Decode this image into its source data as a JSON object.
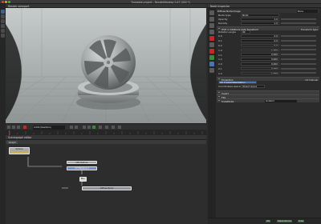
{
  "window": {
    "title": "Tuneable project - RenderMonkey 0.47 (002 *)"
  },
  "viewport_panel": {
    "title": "Render viewport"
  },
  "timeline": {
    "frame_value": "0.000 (Realtime)"
  },
  "graph_panel": {
    "title": "Scenegraph editor",
    "tab": "Graph",
    "nodes": [
      {
        "label": "Sphere"
      },
      {
        "label": "DIN Texture"
      },
      {
        "label": "UV Mapping 1"
      },
      {
        "label": "Blur"
      },
      {
        "label": "Diffuse Rend"
      }
    ]
  },
  "inspector": {
    "title": "Node Inspector",
    "tab_labels": [
      "Diffuse  Node Image",
      "None"
    ],
    "rows": [
      {
        "label": "Node type",
        "value": "Node"
      },
      {
        "label": "Opacity",
        "value": "1.0"
      },
      {
        "label": "Density",
        "value": "1.0"
      }
    ],
    "uv_section": {
      "label": "UVS 1 rotations UVS Transform",
      "right_label": "Transform type",
      "sub_label": "Rotation angle",
      "sub_value": "90",
      "matrix": [
        {
          "label": "0.0",
          "value": "0.0"
        },
        {
          "label": "0.1",
          "value": "0.0"
        },
        {
          "label": "0.2",
          "value": "0.0"
        },
        {
          "label": "1.0",
          "value": "1.000"
        },
        {
          "label": "1.1",
          "value": "0.000"
        },
        {
          "label": "1.2",
          "value": "0.000"
        },
        {
          "label": "2.0",
          "value": "0.000"
        },
        {
          "label": "2.1",
          "value": "0.000"
        },
        {
          "label": "2.2",
          "value": "1.000"
        }
      ]
    },
    "projection_section": {
      "label": "Projection",
      "right_label": "UV Internal",
      "item_label": "UV 2 parameterization",
      "sub_label": "Coordinates space",
      "sub_value": "Object space"
    },
    "extra_rows": [
      {
        "label": "Invert",
        "value": ""
      },
      {
        "label": "Flip",
        "value": ""
      },
      {
        "label": "Substitute",
        "value": "Isolated"
      }
    ]
  },
  "status": {
    "items": [
      "Idle",
      "Dependencies",
      "Draw"
    ]
  },
  "colors": {
    "accent_red": "#c22a2a",
    "accent_green": "#3a8a3a",
    "node_blue": "#4a73b8"
  }
}
